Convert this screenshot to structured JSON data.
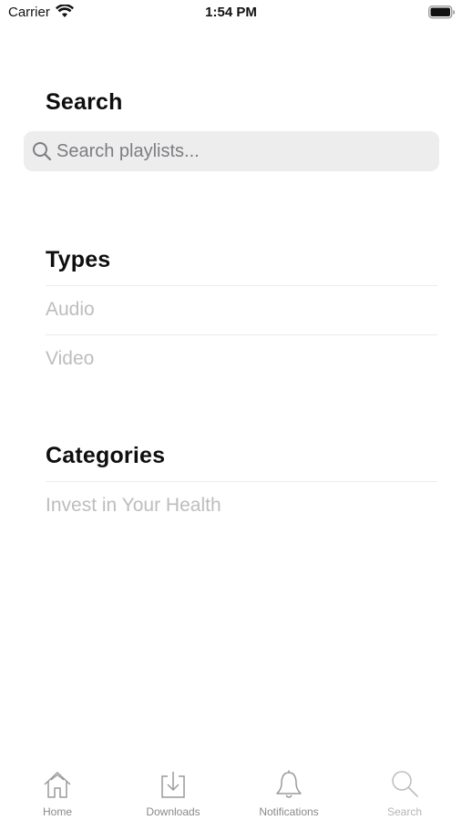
{
  "status_bar": {
    "carrier": "Carrier",
    "time": "1:54 PM",
    "icons": [
      "wifi-icon",
      "battery-icon"
    ]
  },
  "search": {
    "title": "Search",
    "placeholder": "Search playlists...",
    "value": ""
  },
  "types": {
    "title": "Types",
    "items": [
      {
        "label": "Audio"
      },
      {
        "label": "Video"
      }
    ]
  },
  "categories": {
    "title": "Categories",
    "items": [
      {
        "label": "Invest in Your Health"
      }
    ]
  },
  "tab_bar": {
    "tabs": [
      {
        "label": "Home",
        "icon": "home-icon"
      },
      {
        "label": "Downloads",
        "icon": "download-icon"
      },
      {
        "label": "Notifications",
        "icon": "bell-icon"
      },
      {
        "label": "Search",
        "icon": "search-icon"
      }
    ],
    "active_tab": "Search"
  },
  "colors": {
    "background": "#ffffff",
    "search_field": "#ededed",
    "list_text": "#bdbdbd",
    "tab_inactive": "#8a8a8a"
  }
}
